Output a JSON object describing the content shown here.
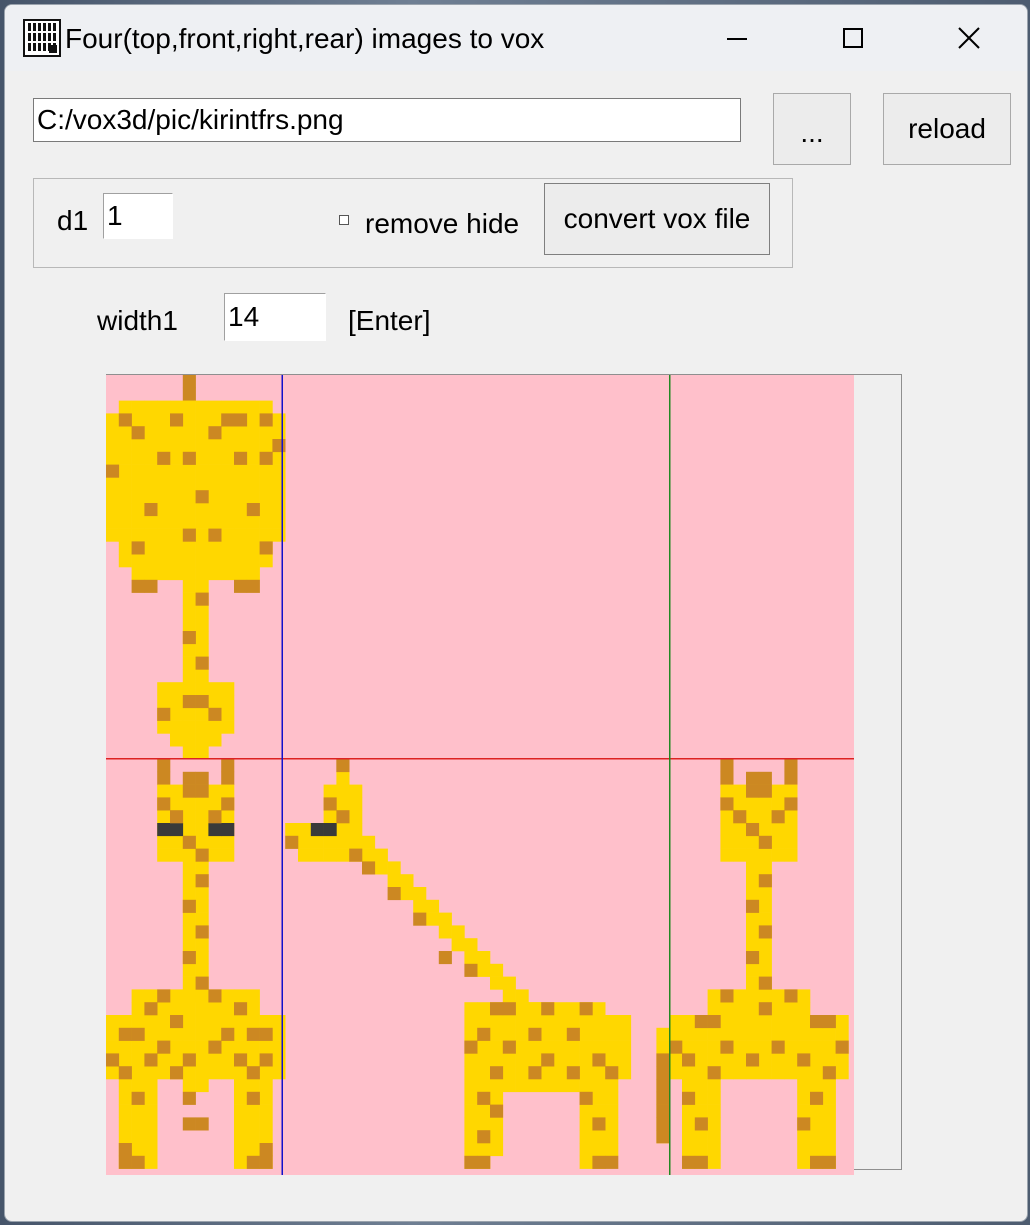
{
  "window": {
    "title": "Four(top,front,right,rear) images to vox"
  },
  "toolbar": {
    "path_value": "C:/vox3d/pic/kirintfrs.png",
    "browse_label": "...",
    "reload_label": "reload"
  },
  "options": {
    "d1_label": "d1",
    "d1_value": "1",
    "remove_hide_label": "remove hide",
    "remove_hide_checked": false,
    "convert_label": "convert vox file",
    "width_label": "width1",
    "width_value": "14",
    "enter_label": "[Enter]"
  },
  "image": {
    "background_color": "#ffc0cb",
    "yellow": "#ffd700",
    "spot": "#cc8822",
    "eye": "#3a3a3a",
    "blue_divider": "#1111cc",
    "green_divider": "#228822",
    "red_divider": "#dd2222"
  }
}
